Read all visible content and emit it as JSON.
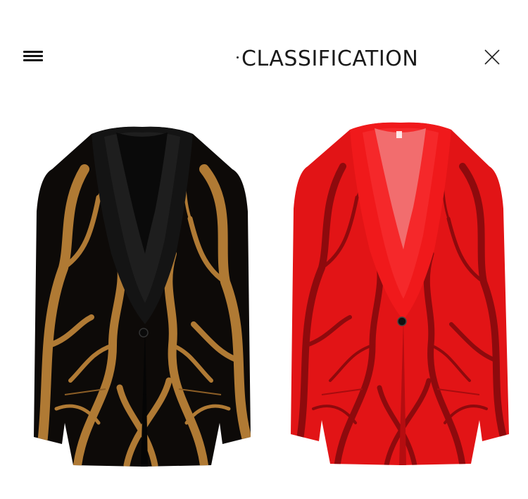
{
  "header": {
    "title": "CLASSIFICATION",
    "menu_icon": "hamburger-menu-icon",
    "close_icon": "close-icon"
  },
  "products": [
    {
      "image": "black-gold-sequin-shawl-lapel-blazer",
      "colors": {
        "base": "#0d0a08",
        "pattern": "#b07a34",
        "lapel": "#141414"
      }
    },
    {
      "image": "red-sequin-shawl-lapel-blazer",
      "colors": {
        "base": "#e21416",
        "pattern": "#8e0a0d",
        "lapel": "#f0191b"
      }
    }
  ]
}
